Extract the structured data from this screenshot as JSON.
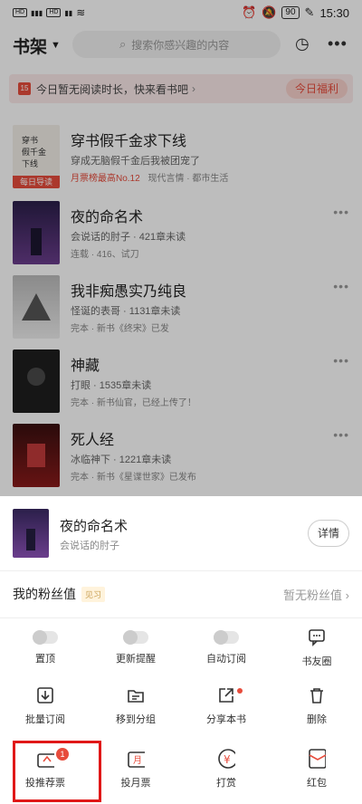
{
  "status_bar": {
    "time": "15:30",
    "battery": "90",
    "left_indicators": "HD1 4G HD2"
  },
  "header": {
    "title": "书架",
    "search_placeholder": "搜索你感兴趣的内容"
  },
  "banner": {
    "day": "15",
    "text": "今日暂无阅读时长，快来看书吧",
    "arrow": "›",
    "welfare_button": "今日福利"
  },
  "books": [
    {
      "title": "穿书假千金求下线",
      "line1": "穿成无脑假千金后我被团宠了",
      "rank": "月票榜最高No.12",
      "tags": "现代言情 · 都市生活",
      "daily_tag": "每日导读"
    },
    {
      "title": "夜的命名术",
      "line1": "会说话的肘子 · 421章未读",
      "line2": "连载 · 416、试刀"
    },
    {
      "title": "我非痴愚实乃纯良",
      "line1": "怪诞的表哥 · 1131章未读",
      "line2": "完本 · 新书《终宋》已发"
    },
    {
      "title": "神藏",
      "line1": "打眼 · 1535章未读",
      "line2": "完本 · 新书仙官，已经上传了！"
    },
    {
      "title": "死人经",
      "line1": "冰临神下 · 1221章未读",
      "line2": "完本 · 新书《星谍世家》已发布"
    }
  ],
  "sheet": {
    "book_title": "夜的命名术",
    "author": "会说话的肘子",
    "detail_button": "详情",
    "fans_label": "我的粉丝值",
    "fans_badge": "见习",
    "fans_value": "暂无粉丝值 ›",
    "row1": [
      "置顶",
      "更新提醒",
      "自动订阅",
      "书友圈"
    ],
    "row2": [
      "批量订阅",
      "移到分组",
      "分享本书",
      "删除"
    ],
    "row3": [
      "投推荐票",
      "投月票",
      "打赏",
      "红包"
    ],
    "recommend_badge": "1"
  },
  "colors": {
    "accent": "#e74c3c",
    "highlight": "#e01818"
  }
}
